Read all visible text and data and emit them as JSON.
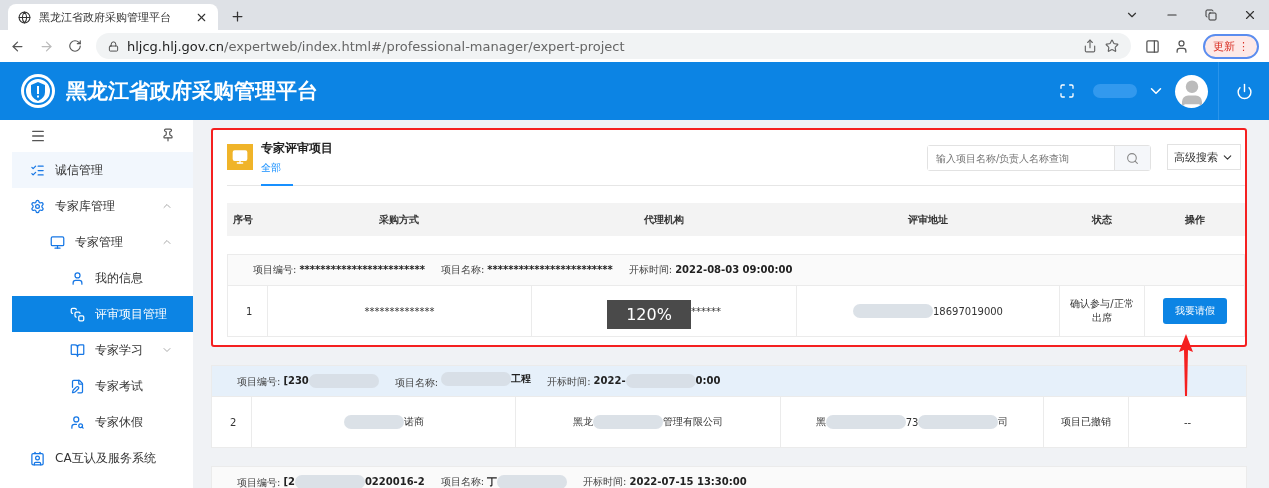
{
  "browser": {
    "tab_title": "黑龙江省政府采购管理平台",
    "url_host": "hljcg.hlj.gov.cn",
    "url_path": "/expertweb/index.html#/professional-manager/expert-project",
    "update_button": "更新",
    "update_menu": "⋮"
  },
  "header": {
    "title": "黑龙江省政府采购管理平台"
  },
  "sidebar": {
    "items": [
      {
        "label": "诚信管理",
        "hovered": true,
        "selected": false
      },
      {
        "label": "专家库管理",
        "hovered": false,
        "selected": false,
        "expanded": true,
        "children": [
          {
            "label": "专家管理",
            "selected": false,
            "expanded": true,
            "children": [
              {
                "label": "我的信息",
                "selected": false
              },
              {
                "label": "评审项目管理",
                "selected": true
              },
              {
                "label": "专家学习",
                "selected": false,
                "expanded": false
              },
              {
                "label": "专家考试",
                "selected": false
              },
              {
                "label": "专家休假",
                "selected": false
              }
            ]
          }
        ]
      },
      {
        "label": "CA互认及服务系统",
        "hovered": false,
        "selected": false
      }
    ]
  },
  "panel": {
    "title": "专家评审项目",
    "tabs": [
      {
        "label": "全部",
        "selected": true
      }
    ],
    "search": {
      "placeholder": "输入项目名称/负责人名称查询"
    },
    "advanced_search": "高级搜索"
  },
  "table": {
    "columns": [
      "序号",
      "采购方式",
      "代理机构",
      "评审地址",
      "状态",
      "操作"
    ],
    "groups": [
      {
        "highlighted": false,
        "fields": [
          {
            "label": "项目编号:",
            "value": [
              {
                "kind": "text",
                "text": "************************"
              }
            ]
          },
          {
            "label": "项目名称:",
            "value": [
              {
                "kind": "text",
                "text": "************************"
              }
            ]
          },
          {
            "label": "开标时间:",
            "value": [
              {
                "kind": "text",
                "text": "2022-08-03 09:00:00"
              }
            ]
          }
        ],
        "row": {
          "index": "1",
          "method": [
            {
              "kind": "text",
              "text": "**************"
            }
          ],
          "zoom_overlay": "120%",
          "agency": [
            {
              "kind": "text",
              "text": "******"
            }
          ],
          "address": [
            {
              "kind": "blur"
            },
            {
              "kind": "text",
              "text": "18697019000"
            }
          ],
          "status": "确认参与/正常出席",
          "action": {
            "kind": "button",
            "label": "我要请假"
          }
        }
      },
      {
        "highlighted": true,
        "fields": [
          {
            "label": "项目编号:",
            "value": [
              {
                "kind": "text",
                "text": "[230"
              },
              {
                "kind": "blur"
              }
            ]
          },
          {
            "label": "项目名称:",
            "value": [
              {
                "kind": "blur"
              },
              {
                "kind": "text",
                "text": "工程"
              }
            ]
          },
          {
            "label": "开标时间:",
            "value": [
              {
                "kind": "text",
                "text": "2022-"
              },
              {
                "kind": "blur"
              },
              {
                "kind": "text",
                "text": "0:00"
              }
            ]
          }
        ],
        "row": {
          "index": "2",
          "method": [
            {
              "kind": "blur"
            },
            {
              "kind": "text",
              "text": "诺商"
            }
          ],
          "agency": [
            {
              "kind": "text",
              "text": "黑龙"
            },
            {
              "kind": "blur"
            },
            {
              "kind": "text",
              "text": "管理有限公司"
            }
          ],
          "address": [
            {
              "kind": "text",
              "text": "黑"
            },
            {
              "kind": "blur"
            },
            {
              "kind": "text",
              "text": "73"
            },
            {
              "kind": "blur"
            },
            {
              "kind": "text",
              "text": "司"
            }
          ],
          "status": "项目已撤销",
          "action": {
            "kind": "text",
            "label": "--"
          }
        }
      },
      {
        "highlighted": false,
        "fields": [
          {
            "label": "项目编号:",
            "value": [
              {
                "kind": "text",
                "text": "[2"
              },
              {
                "kind": "blur"
              },
              {
                "kind": "text",
                "text": "0220016-2"
              }
            ]
          },
          {
            "label": "项目名称:",
            "value": [
              {
                "kind": "text",
                "text": "丁"
              },
              {
                "kind": "blur"
              }
            ]
          },
          {
            "label": "开标时间:",
            "value": [
              {
                "kind": "text",
                "text": "2022-07-15 13:30:00"
              }
            ]
          }
        ]
      }
    ]
  }
}
